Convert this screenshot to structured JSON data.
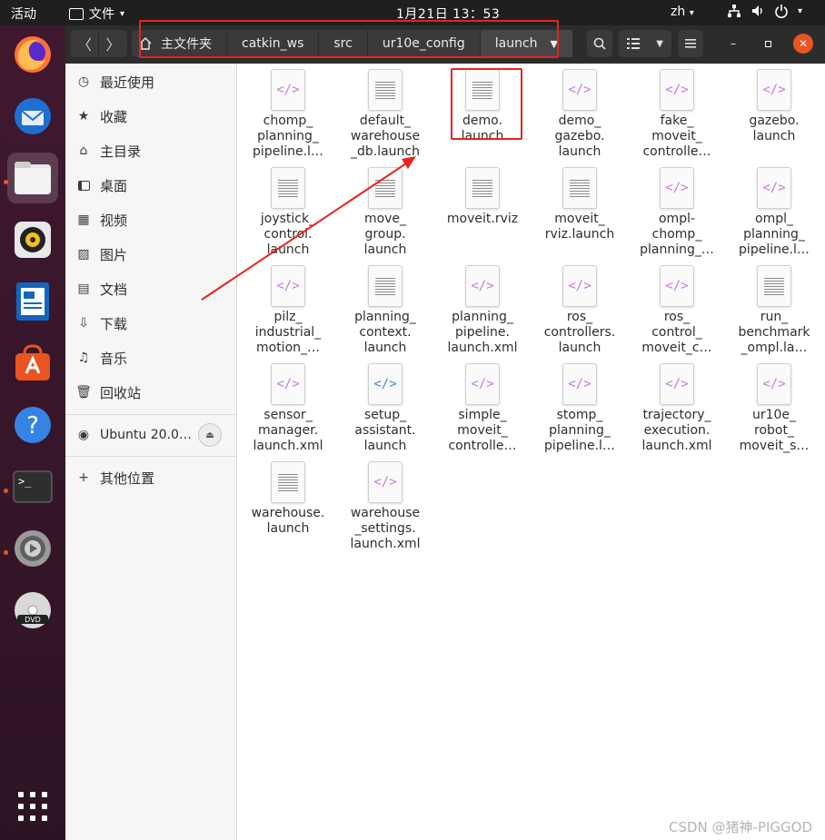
{
  "topbar": {
    "activities": "活动",
    "app_menu": "文件",
    "clock": "1月21日  13：53",
    "lang": "zh"
  },
  "dock": {
    "apps": [
      "firefox-icon",
      "thunderbird-icon",
      "files-icon",
      "rhythmbox-icon",
      "libreoffice-writer-icon",
      "software-center-icon",
      "help-icon",
      "terminal-icon",
      "settings-icon",
      "dvd-icon"
    ]
  },
  "breadcrumb": {
    "home": "主文件夹",
    "items": [
      "catkin_ws",
      "src",
      "ur10e_config",
      "launch"
    ]
  },
  "sidebar": {
    "items": [
      {
        "label": "最近使用",
        "icon": "clock-icon"
      },
      {
        "label": "收藏",
        "icon": "star-icon"
      },
      {
        "label": "主目录",
        "icon": "home-icon"
      },
      {
        "label": "桌面",
        "icon": "desktop-icon"
      },
      {
        "label": "视频",
        "icon": "video-icon"
      },
      {
        "label": "图片",
        "icon": "image-icon"
      },
      {
        "label": "文档",
        "icon": "document-icon"
      },
      {
        "label": "下载",
        "icon": "download-icon"
      },
      {
        "label": "音乐",
        "icon": "music-icon"
      },
      {
        "label": "回收站",
        "icon": "trash-icon"
      }
    ],
    "device": "Ubuntu 20.0…",
    "other": "其他位置"
  },
  "files": [
    {
      "name": "chomp_\nplanning_\npipeline.l…",
      "kind": "xml"
    },
    {
      "name": "default_\nwarehouse\n_db.launch",
      "kind": "text"
    },
    {
      "name": "demo.\nlaunch",
      "kind": "text"
    },
    {
      "name": "demo_\ngazebo.\nlaunch",
      "kind": "xml"
    },
    {
      "name": "fake_\nmoveit_\ncontrolle…",
      "kind": "xml"
    },
    {
      "name": "gazebo.\nlaunch",
      "kind": "xml"
    },
    {
      "name": "joystick_\ncontrol.\nlaunch",
      "kind": "text"
    },
    {
      "name": "move_\ngroup.\nlaunch",
      "kind": "text"
    },
    {
      "name": "moveit.rviz",
      "kind": "text"
    },
    {
      "name": "moveit_\nrviz.launch",
      "kind": "text"
    },
    {
      "name": "ompl-\nchomp_\nplanning_…",
      "kind": "xml"
    },
    {
      "name": "ompl_\nplanning_\npipeline.l…",
      "kind": "xml"
    },
    {
      "name": "pilz_\nindustrial_\nmotion_…",
      "kind": "xml"
    },
    {
      "name": "planning_\ncontext.\nlaunch",
      "kind": "text"
    },
    {
      "name": "planning_\npipeline.\nlaunch.xml",
      "kind": "xml"
    },
    {
      "name": "ros_\ncontrollers.\nlaunch",
      "kind": "xml"
    },
    {
      "name": "ros_\ncontrol_\nmoveit_c…",
      "kind": "xml"
    },
    {
      "name": "run_\nbenchmark\n_ompl.la…",
      "kind": "text"
    },
    {
      "name": "sensor_\nmanager.\nlaunch.xml",
      "kind": "xml"
    },
    {
      "name": "setup_\nassistant.\nlaunch",
      "kind": "xml-blue"
    },
    {
      "name": "simple_\nmoveit_\ncontrolle…",
      "kind": "xml"
    },
    {
      "name": "stomp_\nplanning_\npipeline.l…",
      "kind": "xml"
    },
    {
      "name": "trajectory_\nexecution.\nlaunch.xml",
      "kind": "xml"
    },
    {
      "name": "ur10e_\nrobot_\nmoveit_s…",
      "kind": "xml"
    },
    {
      "name": "warehouse.\nlaunch",
      "kind": "text"
    },
    {
      "name": "warehouse\n_settings.\nlaunch.xml",
      "kind": "xml"
    }
  ],
  "watermark": "CSDN @猪神-PIGGOD",
  "colors": {
    "annotation": "#e8231f",
    "accent": "#e95420"
  }
}
